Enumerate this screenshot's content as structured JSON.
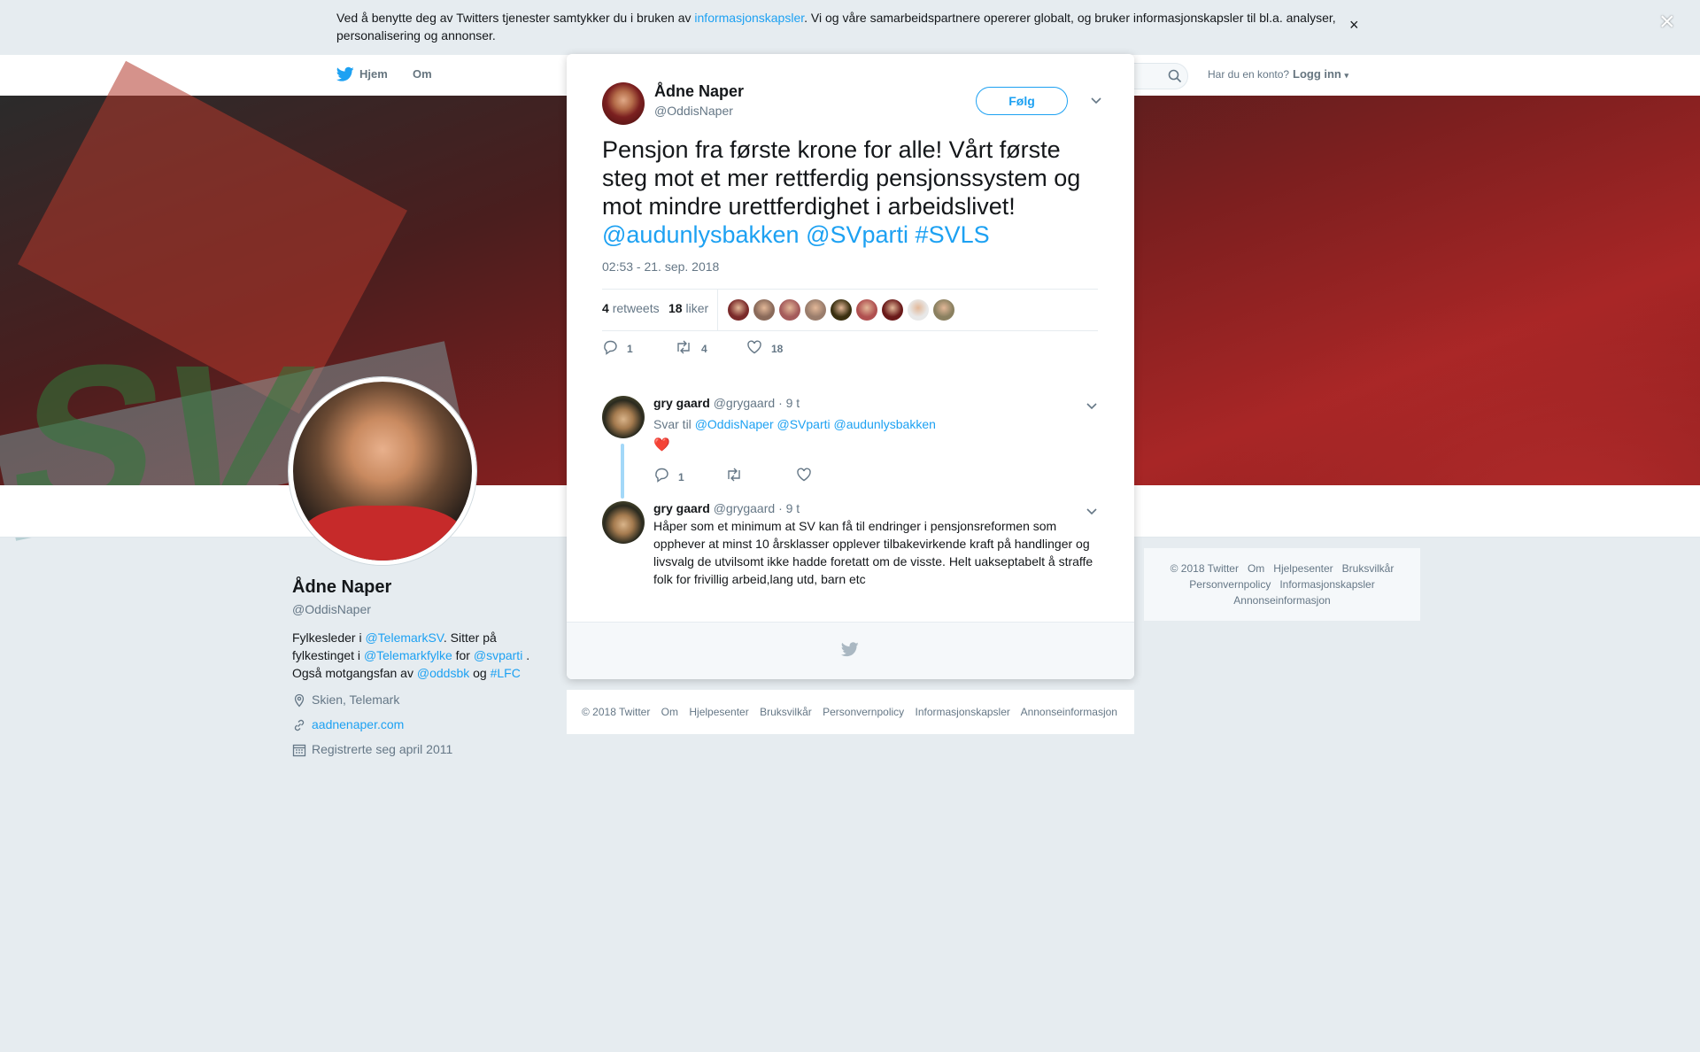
{
  "cookie_banner": {
    "text_before": "Ved å benytte deg av Twitters tjenester samtykker du i bruken av ",
    "link": "informasjonskapsler",
    "text_after": ". Vi og våre samarbeidspartnere opererer globalt, og bruker informasjonskapsler til bl.a. analyser, personalisering og annonser.",
    "close": "×"
  },
  "nav": {
    "home": "Hjem",
    "about": "Om",
    "have_account": "Har du en konto?",
    "login": "Logg inn"
  },
  "overlay_close": "×",
  "profile": {
    "name": "Ådne Naper",
    "handle": "@OddisNaper",
    "bio": {
      "t1": "Fylkesleder i ",
      "m1": "@TelemarkSV",
      "t2": ". Sitter på fylkestinget i ",
      "m2": "@Telemarkfylke",
      "t3": " for ",
      "m3": "@svparti",
      "t4": " . Også motgangsfan av ",
      "m4": "@oddsbk",
      "t5": " og ",
      "m5": "#LFC"
    },
    "location": "Skien, Telemark",
    "website": "aadnenaper.com",
    "joined": "Registrerte seg april 2011"
  },
  "right_footer": {
    "items": [
      "© 2018 Twitter",
      "Om",
      "Hjelpesenter",
      "Bruksvilkår",
      "Personvernpolicy",
      "Informasjonskapsler",
      "Annonseinformasjon"
    ]
  },
  "tweet": {
    "author_name": "Ådne Naper",
    "author_handle": "@OddisNaper",
    "follow": "Følg",
    "text": "Pensjon fra første krone for alle! Vårt første steg mot et mer rettferdig pensjonssystem og mot mindre urettferdighet i arbeidslivet! ",
    "tag1": "@audunlysbakken",
    "tag2": "@SVparti",
    "tag3": "#SVLS",
    "time": "02:53 - 21. sep. 2018",
    "retweets_count": "4",
    "retweets_label": "retweets",
    "likes_count": "18",
    "likes_label": "liker",
    "reply_count": "1",
    "rt_count": "4",
    "like_count": "18",
    "liker_colors": [
      "#7a2a2a",
      "#8a6a5a",
      "#a45b5b",
      "#9a7d6c",
      "#3a3010",
      "#b05050",
      "#6a1a1a",
      "#e8e8e8",
      "#8a8060"
    ]
  },
  "replies": [
    {
      "name": "gry gaard",
      "handle": "@grygaard",
      "time": "· 9 t",
      "reply_to_label": "Svar til ",
      "reply_to": [
        "@OddisNaper",
        "@SVparti",
        "@audunlysbakken"
      ],
      "body": "❤️",
      "reply_count": "1"
    },
    {
      "name": "gry gaard",
      "handle": "@grygaard",
      "time": "· 9 t",
      "body": "Håper som et minimum at SV kan få til endringer i pensjonsreformen som opphever at minst 10 årsklasser opplever tilbakevirkende kraft på handlinger og livsvalg de utvilsomt ikke hadde foretatt om de visste. Helt uakseptabelt å straffe folk for frivillig arbeid,lang utd, barn etc"
    }
  ],
  "modal_footer": {
    "items": [
      "© 2018 Twitter",
      "Om",
      "Hjelpesenter",
      "Bruksvilkår",
      "Personvernpolicy",
      "Informasjonskapsler",
      "Annonseinformasjon"
    ]
  },
  "colors": {
    "accent": "#1da1f2",
    "like_heart": "#e0245e"
  }
}
